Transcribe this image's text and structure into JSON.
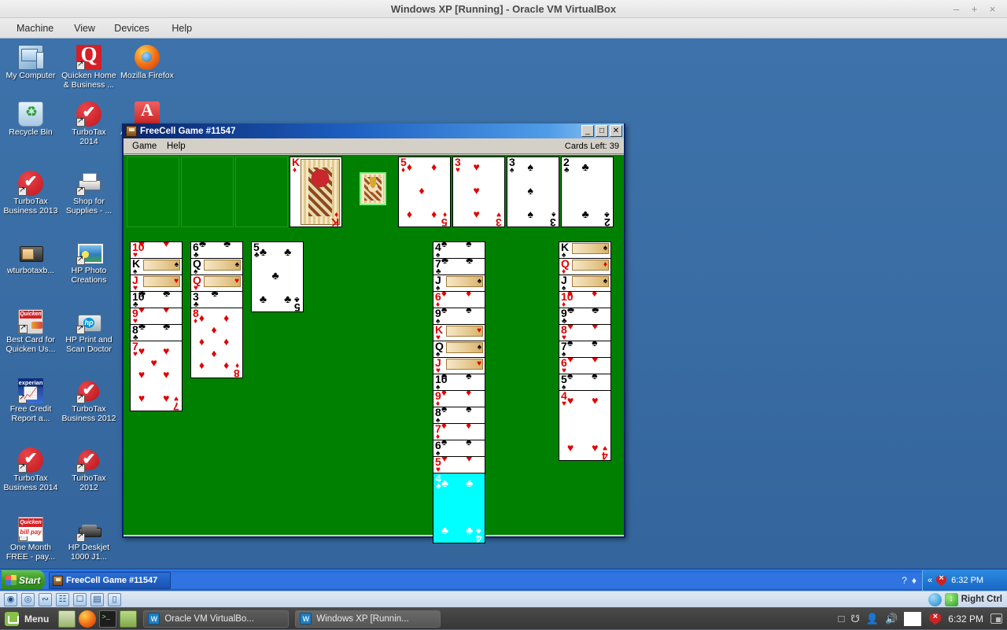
{
  "vbox": {
    "title": "Windows XP [Running] - Oracle VM VirtualBox",
    "menus": [
      "Machine",
      "View",
      "Devices",
      "Help"
    ],
    "window_buttons": {
      "minimize": "–",
      "maximize": "+",
      "close": "×"
    }
  },
  "desktop": {
    "icons": [
      {
        "name": "my-computer",
        "label": "My Computer",
        "art": "ic-mycomputer",
        "shortcut": false
      },
      {
        "name": "quicken-home-business",
        "label": "Quicken Home\n& Business ...",
        "art": "ic-quicken",
        "shortcut": true
      },
      {
        "name": "mozilla-firefox",
        "label": "Mozilla Firefox",
        "art": "ic-firefox",
        "shortcut": false
      },
      {
        "name": "recycle-bin",
        "label": "Recycle Bin",
        "art": "ic-recycle",
        "shortcut": false
      },
      {
        "name": "turbotax-2014",
        "label": "TurboTax\n2014",
        "art": "ic-turbotax",
        "shortcut": true
      },
      {
        "name": "adobe-reader-xi",
        "label": "Adobe Reader\nXI",
        "art": "ic-adobe",
        "shortcut": false
      },
      {
        "name": "turbotax-business-2013",
        "label": "TurboTax\nBusiness 2013",
        "art": "ic-turbotax",
        "shortcut": true
      },
      {
        "name": "shop-for-supplies",
        "label": "Shop for\nSupplies - ...",
        "art": "ic-printer",
        "shortcut": true
      },
      {
        "name": "wturbotaxb",
        "label": "wturbotaxb...",
        "art": "ic-wturbo",
        "shortcut": false
      },
      {
        "name": "hp-photo-creations",
        "label": "HP Photo\nCreations",
        "art": "ic-hpphoto",
        "shortcut": true
      },
      {
        "name": "best-card-for-quicken",
        "label": "Best Card for\nQuicken Us...",
        "art": "ic-quickencard",
        "shortcut": true
      },
      {
        "name": "hp-print-and-scan-doctor",
        "label": "HP Print and\nScan Doctor",
        "art": "ic-hpcase",
        "shortcut": true
      },
      {
        "name": "free-credit-report",
        "label": "Free Credit\nReport a...",
        "art": "ic-experian",
        "shortcut": true
      },
      {
        "name": "turbotax-business-2012",
        "label": "TurboTax\nBusiness 2012",
        "art": "ic-turbotax2",
        "shortcut": true
      },
      {
        "name": "turbotax-business-2014",
        "label": "TurboTax\nBusiness 2014",
        "art": "ic-turbotax",
        "shortcut": true
      },
      {
        "name": "turbotax-2012",
        "label": "TurboTax\n2012",
        "art": "ic-turbotax2",
        "shortcut": true
      },
      {
        "name": "one-month-free-bill-pay",
        "label": "One Month\nFREE - pay...",
        "art": "ic-billpay",
        "shortcut": true
      },
      {
        "name": "hp-deskjet-1000",
        "label": "HP Deskjet\n1000 J1...",
        "art": "ic-deskjet",
        "shortcut": true
      }
    ]
  },
  "freecell": {
    "title": "FreeCell Game #11547",
    "menus": [
      "Game",
      "Help"
    ],
    "cards_left": "Cards Left: 39",
    "window_buttons": {
      "minimize": "_",
      "maximize": "□",
      "close": "✕"
    },
    "free_cells": [
      {
        "empty": true
      },
      {
        "empty": true
      },
      {
        "empty": true
      },
      {
        "empty": false,
        "rank": "K",
        "suit": "♦",
        "color": "red",
        "face": true
      }
    ],
    "foundations": [
      {
        "rank": "5",
        "suit": "♦",
        "color": "red"
      },
      {
        "rank": "3",
        "suit": "♥",
        "color": "red"
      },
      {
        "rank": "3",
        "suit": "♠",
        "color": "black"
      },
      {
        "rank": "2",
        "suit": "♣",
        "color": "black"
      }
    ],
    "drag_card": {
      "rank": "K",
      "suit": "♦",
      "color": "red"
    },
    "columns": [
      {
        "name": "column-1",
        "cards": [
          {
            "rank": "10",
            "suit": "♥",
            "color": "red"
          },
          {
            "rank": "K",
            "suit": "♠",
            "color": "black",
            "face": true
          },
          {
            "rank": "J",
            "suit": "♥",
            "color": "red",
            "face": true
          },
          {
            "rank": "10",
            "suit": "♣",
            "color": "black"
          },
          {
            "rank": "9",
            "suit": "♥",
            "color": "red"
          },
          {
            "rank": "8",
            "suit": "♣",
            "color": "black"
          },
          {
            "rank": "7",
            "suit": "♥",
            "color": "red"
          }
        ]
      },
      {
        "name": "column-2",
        "cards": [
          {
            "rank": "6",
            "suit": "♣",
            "color": "black"
          },
          {
            "rank": "Q",
            "suit": "♠",
            "color": "black",
            "face": true
          },
          {
            "rank": "Q",
            "suit": "♥",
            "color": "red",
            "face": true
          },
          {
            "rank": "3",
            "suit": "♣",
            "color": "black"
          },
          {
            "rank": "8",
            "suit": "♦",
            "color": "red"
          }
        ]
      },
      {
        "name": "column-3",
        "cards": [
          {
            "rank": "5",
            "suit": "♣",
            "color": "black"
          }
        ]
      },
      {
        "name": "column-4",
        "cards": []
      },
      {
        "name": "column-5",
        "cards": []
      },
      {
        "name": "column-6",
        "cards": [
          {
            "rank": "4",
            "suit": "♠",
            "color": "black"
          },
          {
            "rank": "7",
            "suit": "♣",
            "color": "black"
          },
          {
            "rank": "J",
            "suit": "♠",
            "color": "black",
            "face": true
          },
          {
            "rank": "6",
            "suit": "♦",
            "color": "red"
          },
          {
            "rank": "9",
            "suit": "♠",
            "color": "black"
          },
          {
            "rank": "K",
            "suit": "♥",
            "color": "red",
            "face": true
          },
          {
            "rank": "Q",
            "suit": "♠",
            "color": "black",
            "face": true
          },
          {
            "rank": "J",
            "suit": "♥",
            "color": "red",
            "face": true
          },
          {
            "rank": "10",
            "suit": "♠",
            "color": "black"
          },
          {
            "rank": "9",
            "suit": "♦",
            "color": "red"
          },
          {
            "rank": "8",
            "suit": "♠",
            "color": "black"
          },
          {
            "rank": "7",
            "suit": "♦",
            "color": "red"
          },
          {
            "rank": "6",
            "suit": "♠",
            "color": "black"
          },
          {
            "rank": "5",
            "suit": "♥",
            "color": "red"
          },
          {
            "rank": "4",
            "suit": "♣",
            "color": "black",
            "selected": true
          }
        ]
      },
      {
        "name": "column-7",
        "cards": []
      },
      {
        "name": "column-8",
        "cards": [
          {
            "rank": "K",
            "suit": "♠",
            "color": "black",
            "face": true
          },
          {
            "rank": "Q",
            "suit": "♦",
            "color": "red",
            "face": true
          },
          {
            "rank": "J",
            "suit": "♠",
            "color": "black",
            "face": true
          },
          {
            "rank": "10",
            "suit": "♦",
            "color": "red"
          },
          {
            "rank": "9",
            "suit": "♣",
            "color": "black"
          },
          {
            "rank": "8",
            "suit": "♥",
            "color": "red"
          },
          {
            "rank": "7",
            "suit": "♠",
            "color": "black"
          },
          {
            "rank": "6",
            "suit": "♥",
            "color": "red"
          },
          {
            "rank": "5",
            "suit": "♠",
            "color": "black"
          },
          {
            "rank": "4",
            "suit": "♥",
            "color": "red"
          }
        ]
      }
    ]
  },
  "xp_taskbar": {
    "start_label": "Start",
    "task_label": "FreeCell Game #11547",
    "clock": "6:32 PM",
    "chevron": "«",
    "help_icon": "?",
    "right_ctrl_label": "Right Ctrl"
  },
  "host_panel": {
    "menu_label": "Menu",
    "windows": [
      {
        "name": "host-window-virtualbox",
        "label": "Oracle VM VirtualBo...",
        "active": false
      },
      {
        "name": "host-window-winxp",
        "label": "Windows XP [Runnin...",
        "active": true
      }
    ],
    "clock": "6:32 PM"
  },
  "colors": {
    "felt": "#008000",
    "card_red": "#e00000",
    "selected_card": "#00ffff",
    "xp_blue": "#3a6ea5",
    "title_blue": "#0a246a"
  }
}
